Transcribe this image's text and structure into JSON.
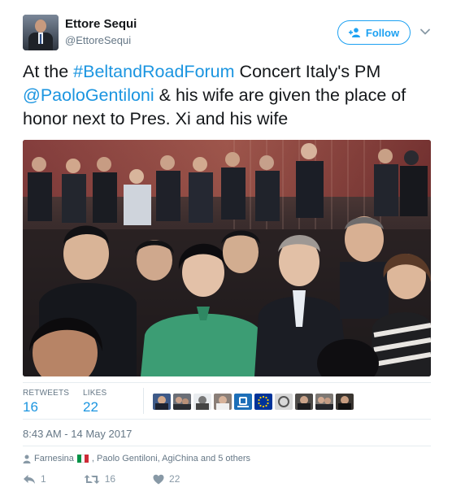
{
  "author": {
    "name": "Ettore Sequi",
    "handle": "@EttoreSequi"
  },
  "follow_button": {
    "label": "Follow"
  },
  "tweet": {
    "text_prefix": "At the ",
    "hashtag": "#BeltandRoadForum",
    "text_middle": " Concert Italy's PM ",
    "mention": "@PaoloGentiloni",
    "text_suffix": " & his wife are given the place of honor next to Pres. Xi and his wife"
  },
  "stats": {
    "retweets_label": "RETWEETS",
    "retweets_count": "16",
    "likes_label": "LIKES",
    "likes_count": "22"
  },
  "timestamp": "8:43 AM - 14 May 2017",
  "context": {
    "text_before_flag": "Farnesina",
    "text_after_flag": ", Paolo Gentiloni, AgiChina and 5 others"
  },
  "actions": {
    "reply_count": "1",
    "retweet_count": "16",
    "like_count": "22"
  },
  "colors": {
    "link": "#1b95e0",
    "follow": "#1da1f2",
    "secondary_text": "#657786"
  }
}
